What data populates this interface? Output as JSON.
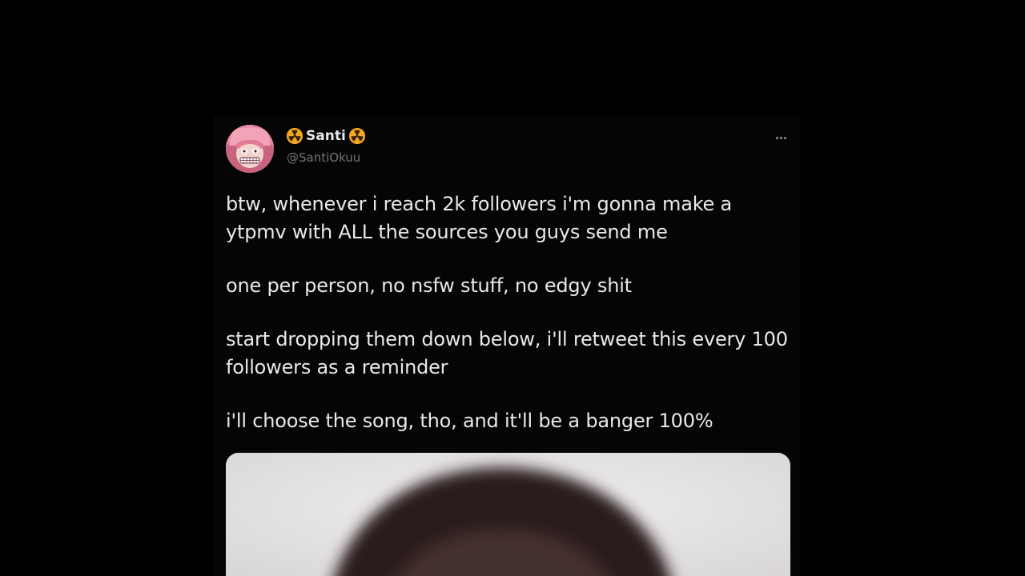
{
  "tweet": {
    "display_name": "Santi",
    "name_emoji_left": "hazard-icon",
    "name_emoji_right": "hazard-icon",
    "handle": "@SantiOkuu",
    "more_icon": "more-horizontal-icon",
    "paragraphs": [
      "btw, whenever i reach 2k followers i'm gonna make a ytpmv with ALL the sources you guys send me",
      "one per person, no nsfw stuff, no edgy shit",
      "start dropping them down below, i'll retweet this every 100 followers as a reminder",
      "i'll choose the song, tho, and it'll be a banger 100%"
    ]
  },
  "colors": {
    "background": "#000000",
    "card": "#050505",
    "text": "#e7e9ea",
    "muted": "#71767b",
    "hazard": "#f5a623",
    "media_bg": "#e9e7e8"
  }
}
